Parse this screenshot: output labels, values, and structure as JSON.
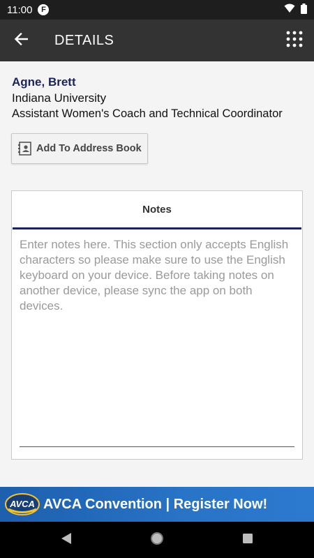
{
  "status_bar": {
    "time": "11:00",
    "badge": "F",
    "icons": [
      "wifi-icon",
      "battery-icon"
    ]
  },
  "app_bar": {
    "title": "DETAILS",
    "back_icon": "arrow-back-icon",
    "menu_icon": "grid-menu-icon"
  },
  "contact": {
    "name": "Agne, Brett",
    "organization": "Indiana University",
    "role": "Assistant Women's Coach and Technical Coordinator"
  },
  "address_button": {
    "label": "Add To Address Book",
    "icon": "contact-card-icon"
  },
  "notes": {
    "title": "Notes",
    "placeholder": "Enter notes here. This section only accepts English characters so please make sure to use the English keyboard on your device. Before taking notes on another device, please sync the app on both devices.",
    "value": ""
  },
  "banner": {
    "logo_text": "AVCA",
    "text": "AVCA Convention | Register Now!"
  },
  "colors": {
    "app_bar": "#333333",
    "status_bar": "#1e1e1e",
    "accent_navy": "#1b2359",
    "banner_blue": "#2874c6"
  }
}
